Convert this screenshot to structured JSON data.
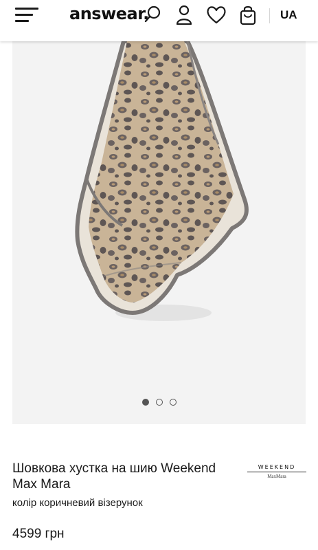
{
  "header": {
    "logo_text": "answear.",
    "language": "UA",
    "icons": [
      "menu-icon",
      "search-icon",
      "user-icon",
      "heart-icon",
      "bag-icon"
    ]
  },
  "gallery": {
    "image_alt": "Leopard print silk neck scarf",
    "slide_count": 3,
    "active_slide": 1
  },
  "product": {
    "title": "Шовкова хустка на шию Weekend Max Mara",
    "color": "колір коричневий візерунок",
    "price": "4599 грн",
    "brand_logo": {
      "main": "WEEKEND",
      "sub": "MaxMara"
    }
  }
}
